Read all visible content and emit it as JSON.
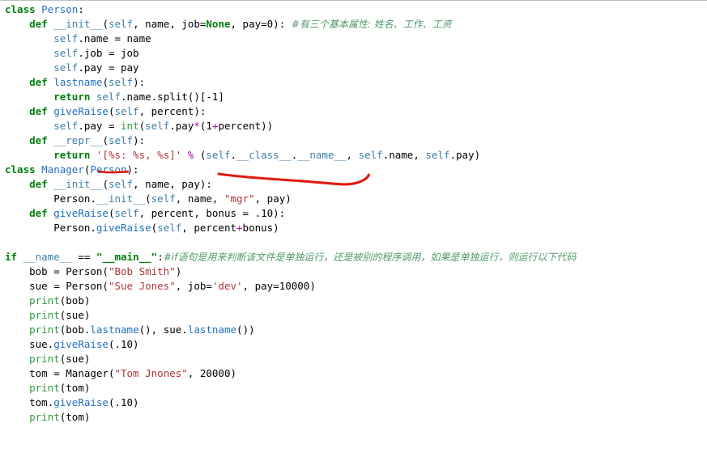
{
  "editor": {
    "language": "python",
    "background_color": "#ffffff",
    "annotation_color": "#e01b10",
    "top_rule_color": "#bfbfbf"
  },
  "colors": {
    "keyword": "#007F0E",
    "class_name": "#2A6FBE",
    "function_name": "#1F6FBF",
    "self_param": "#3C7FA8",
    "builtin": "#2E9B3E",
    "string": "#B03535",
    "operator": "#B000B0",
    "comment": "#4F9A6B",
    "plain": "#000000"
  },
  "code": {
    "lines": [
      {
        "indent": 0,
        "tokens": [
          {
            "t": "class ",
            "c": "kw"
          },
          {
            "t": "Person",
            "c": "cls"
          },
          {
            "t": ":",
            "c": "plain"
          }
        ]
      },
      {
        "indent": 1,
        "tokens": [
          {
            "t": "def ",
            "c": "kw"
          },
          {
            "t": "__init__",
            "c": "dunder"
          },
          {
            "t": "(",
            "c": "plain"
          },
          {
            "t": "self",
            "c": "self"
          },
          {
            "t": ", name, job=",
            "c": "plain"
          },
          {
            "t": "None",
            "c": "const"
          },
          {
            "t": ", pay=0): ",
            "c": "plain"
          },
          {
            "t": "#有三个基本属性: 姓名、工作、工资",
            "c": "comment"
          }
        ]
      },
      {
        "indent": 2,
        "tokens": [
          {
            "t": "self",
            "c": "self"
          },
          {
            "t": ".name = name",
            "c": "plain"
          }
        ]
      },
      {
        "indent": 2,
        "tokens": [
          {
            "t": "self",
            "c": "self"
          },
          {
            "t": ".job = job",
            "c": "plain"
          }
        ]
      },
      {
        "indent": 2,
        "tokens": [
          {
            "t": "self",
            "c": "self"
          },
          {
            "t": ".pay = pay",
            "c": "plain"
          }
        ]
      },
      {
        "indent": 1,
        "tokens": [
          {
            "t": "def ",
            "c": "kw"
          },
          {
            "t": "lastname",
            "c": "fn"
          },
          {
            "t": "(",
            "c": "plain"
          },
          {
            "t": "self",
            "c": "self"
          },
          {
            "t": "):",
            "c": "plain"
          }
        ]
      },
      {
        "indent": 2,
        "tokens": [
          {
            "t": "return ",
            "c": "kw"
          },
          {
            "t": "self",
            "c": "self"
          },
          {
            "t": ".name.split()[-1]",
            "c": "plain"
          }
        ]
      },
      {
        "indent": 1,
        "tokens": [
          {
            "t": "def ",
            "c": "kw"
          },
          {
            "t": "giveRaise",
            "c": "fn"
          },
          {
            "t": "(",
            "c": "plain"
          },
          {
            "t": "self",
            "c": "self"
          },
          {
            "t": ", percent):",
            "c": "plain"
          }
        ]
      },
      {
        "indent": 2,
        "tokens": [
          {
            "t": "self",
            "c": "self"
          },
          {
            "t": ".pay = ",
            "c": "plain"
          },
          {
            "t": "int",
            "c": "builtin"
          },
          {
            "t": "(",
            "c": "plain"
          },
          {
            "t": "self",
            "c": "self"
          },
          {
            "t": ".pay",
            "c": "plain"
          },
          {
            "t": "*",
            "c": "op"
          },
          {
            "t": "(1",
            "c": "plain"
          },
          {
            "t": "+",
            "c": "op"
          },
          {
            "t": "percent))",
            "c": "plain"
          }
        ]
      },
      {
        "indent": 1,
        "tokens": [
          {
            "t": "def ",
            "c": "kw"
          },
          {
            "t": "__repr__",
            "c": "dunder"
          },
          {
            "t": "(",
            "c": "plain"
          },
          {
            "t": "self",
            "c": "self"
          },
          {
            "t": "):",
            "c": "plain"
          }
        ]
      },
      {
        "indent": 2,
        "tokens": [
          {
            "t": "return ",
            "c": "kw"
          },
          {
            "t": "'[%s: %s, %s]'",
            "c": "str"
          },
          {
            "t": " ",
            "c": "plain"
          },
          {
            "t": "%",
            "c": "op"
          },
          {
            "t": " (",
            "c": "plain"
          },
          {
            "t": "self",
            "c": "self"
          },
          {
            "t": ".",
            "c": "plain"
          },
          {
            "t": "__class__",
            "c": "dunder"
          },
          {
            "t": ".",
            "c": "plain"
          },
          {
            "t": "__name__",
            "c": "dunder"
          },
          {
            "t": ", ",
            "c": "plain"
          },
          {
            "t": "self",
            "c": "self"
          },
          {
            "t": ".name, ",
            "c": "plain"
          },
          {
            "t": "self",
            "c": "self"
          },
          {
            "t": ".pay)",
            "c": "plain"
          }
        ]
      },
      {
        "indent": 0,
        "tokens": [
          {
            "t": "class ",
            "c": "kw"
          },
          {
            "t": "Manager",
            "c": "cls"
          },
          {
            "t": "(",
            "c": "plain"
          },
          {
            "t": "Person",
            "c": "cls"
          },
          {
            "t": "):",
            "c": "plain"
          }
        ]
      },
      {
        "indent": 1,
        "tokens": [
          {
            "t": "def ",
            "c": "kw"
          },
          {
            "t": "__init__",
            "c": "dunder"
          },
          {
            "t": "(",
            "c": "plain"
          },
          {
            "t": "self",
            "c": "self"
          },
          {
            "t": ", name, pay):",
            "c": "plain"
          }
        ]
      },
      {
        "indent": 2,
        "tokens": [
          {
            "t": "Person",
            "c": "plain"
          },
          {
            "t": ".",
            "c": "plain"
          },
          {
            "t": "__init__",
            "c": "dunder"
          },
          {
            "t": "(",
            "c": "plain"
          },
          {
            "t": "self",
            "c": "self"
          },
          {
            "t": ", name, ",
            "c": "plain"
          },
          {
            "t": "\"mgr\"",
            "c": "str"
          },
          {
            "t": ", pay)",
            "c": "plain"
          }
        ]
      },
      {
        "indent": 1,
        "tokens": [
          {
            "t": "def ",
            "c": "kw"
          },
          {
            "t": "giveRaise",
            "c": "fn"
          },
          {
            "t": "(",
            "c": "plain"
          },
          {
            "t": "self",
            "c": "self"
          },
          {
            "t": ", percent, bonus = .10):",
            "c": "plain"
          }
        ]
      },
      {
        "indent": 2,
        "tokens": [
          {
            "t": "Person.",
            "c": "plain"
          },
          {
            "t": "giveRaise",
            "c": "fn"
          },
          {
            "t": "(",
            "c": "plain"
          },
          {
            "t": "self",
            "c": "self"
          },
          {
            "t": ", percent",
            "c": "plain"
          },
          {
            "t": "+",
            "c": "op"
          },
          {
            "t": "bonus)",
            "c": "plain"
          }
        ]
      },
      {
        "indent": 0,
        "tokens": []
      },
      {
        "indent": 0,
        "tokens": [
          {
            "t": "if ",
            "c": "kw"
          },
          {
            "t": "__name__",
            "c": "dunder"
          },
          {
            "t": " ",
            "c": "plain"
          },
          {
            "t": "==",
            "c": "plain"
          },
          {
            "t": " ",
            "c": "plain"
          },
          {
            "t": "\"__main__\"",
            "c": "const"
          },
          {
            "t": ":",
            "c": "plain"
          },
          {
            "t": "#if语句是用来判断该文件是单独运行，还是被别的程序调用，如果是单独运行，则运行以下代码",
            "c": "comment"
          }
        ]
      },
      {
        "indent": 1,
        "tokens": [
          {
            "t": "bob = ",
            "c": "plain"
          },
          {
            "t": "Person",
            "c": "plain"
          },
          {
            "t": "(",
            "c": "plain"
          },
          {
            "t": "\"Bob Smith\"",
            "c": "str"
          },
          {
            "t": ")",
            "c": "plain"
          }
        ]
      },
      {
        "indent": 1,
        "tokens": [
          {
            "t": "sue = ",
            "c": "plain"
          },
          {
            "t": "Person",
            "c": "plain"
          },
          {
            "t": "(",
            "c": "plain"
          },
          {
            "t": "\"Sue Jones\"",
            "c": "str"
          },
          {
            "t": ", job=",
            "c": "plain"
          },
          {
            "t": "'dev'",
            "c": "str"
          },
          {
            "t": ", pay=10000)",
            "c": "plain"
          }
        ]
      },
      {
        "indent": 1,
        "tokens": [
          {
            "t": "print",
            "c": "builtin"
          },
          {
            "t": "(bob)",
            "c": "plain"
          }
        ]
      },
      {
        "indent": 1,
        "tokens": [
          {
            "t": "print",
            "c": "builtin"
          },
          {
            "t": "(sue)",
            "c": "plain"
          }
        ]
      },
      {
        "indent": 1,
        "tokens": [
          {
            "t": "print",
            "c": "builtin"
          },
          {
            "t": "(bob.",
            "c": "plain"
          },
          {
            "t": "lastname",
            "c": "fn"
          },
          {
            "t": "(), sue.",
            "c": "plain"
          },
          {
            "t": "lastname",
            "c": "fn"
          },
          {
            "t": "())",
            "c": "plain"
          }
        ]
      },
      {
        "indent": 1,
        "tokens": [
          {
            "t": "sue.",
            "c": "plain"
          },
          {
            "t": "giveRaise",
            "c": "fn"
          },
          {
            "t": "(.10)",
            "c": "plain"
          }
        ]
      },
      {
        "indent": 1,
        "tokens": [
          {
            "t": "print",
            "c": "builtin"
          },
          {
            "t": "(sue)",
            "c": "plain"
          }
        ]
      },
      {
        "indent": 1,
        "tokens": [
          {
            "t": "tom = ",
            "c": "plain"
          },
          {
            "t": "Manager",
            "c": "plain"
          },
          {
            "t": "(",
            "c": "plain"
          },
          {
            "t": "\"Tom Jnones\"",
            "c": "str"
          },
          {
            "t": ", 20000)",
            "c": "plain"
          }
        ]
      },
      {
        "indent": 1,
        "tokens": [
          {
            "t": "print",
            "c": "builtin"
          },
          {
            "t": "(tom)",
            "c": "plain"
          }
        ]
      },
      {
        "indent": 1,
        "tokens": [
          {
            "t": "tom.",
            "c": "plain"
          },
          {
            "t": "giveRaise",
            "c": "fn"
          },
          {
            "t": "(.10)",
            "c": "plain"
          }
        ]
      },
      {
        "indent": 1,
        "tokens": [
          {
            "t": "print",
            "c": "builtin"
          },
          {
            "t": "(tom)",
            "c": "plain"
          }
        ]
      }
    ]
  },
  "annotations": [
    {
      "name": "red-underline-format-spec",
      "shape": "short-underline",
      "target_text": "%s:",
      "color": "#e01b10"
    },
    {
      "name": "red-underline-class-name-expression",
      "shape": "long-wavy-underline",
      "target_text": "self.__class__.__name__",
      "color": "#e01b10"
    }
  ]
}
